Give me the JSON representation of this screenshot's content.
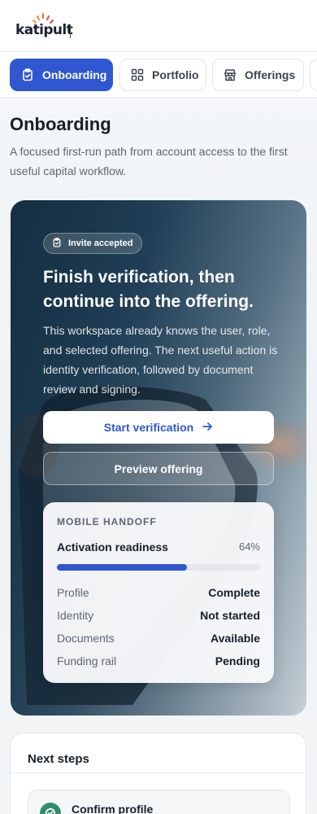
{
  "brand": {
    "logo_text": "katipult"
  },
  "tabs": [
    {
      "label": "Onboarding",
      "icon": "clipboard-icon",
      "active": true
    },
    {
      "label": "Portfolio",
      "icon": "grid-icon",
      "active": false
    },
    {
      "label": "Offerings",
      "icon": "store-icon",
      "active": false
    },
    {
      "label": "",
      "icon": "",
      "active": false
    }
  ],
  "page": {
    "title": "Onboarding",
    "subtitle": "A focused first-run path from account access to the first useful capital workflow."
  },
  "hero": {
    "badge": "Invite accepted",
    "title": "Finish verification, then continue into the offering.",
    "body": "This workspace already knows the user, role, and selected offering. The next useful action is identity verification, followed by document review and signing.",
    "primary_button": "Start verification",
    "secondary_button": "Preview offering"
  },
  "handoff": {
    "kicker": "MOBILE HANDOFF",
    "readiness_label": "Activation readiness",
    "readiness_pct": "64%",
    "readiness_value": 0.64,
    "statuses": [
      {
        "key": "Profile",
        "value": "Complete"
      },
      {
        "key": "Identity",
        "value": "Not started"
      },
      {
        "key": "Documents",
        "value": "Available"
      },
      {
        "key": "Funding rail",
        "value": "Pending"
      }
    ]
  },
  "next_steps": {
    "title": "Next steps",
    "items": [
      {
        "label": "Confirm profile",
        "done": true
      }
    ]
  },
  "colors": {
    "accent": "#2f57d1",
    "success": "#2f8f6a"
  }
}
